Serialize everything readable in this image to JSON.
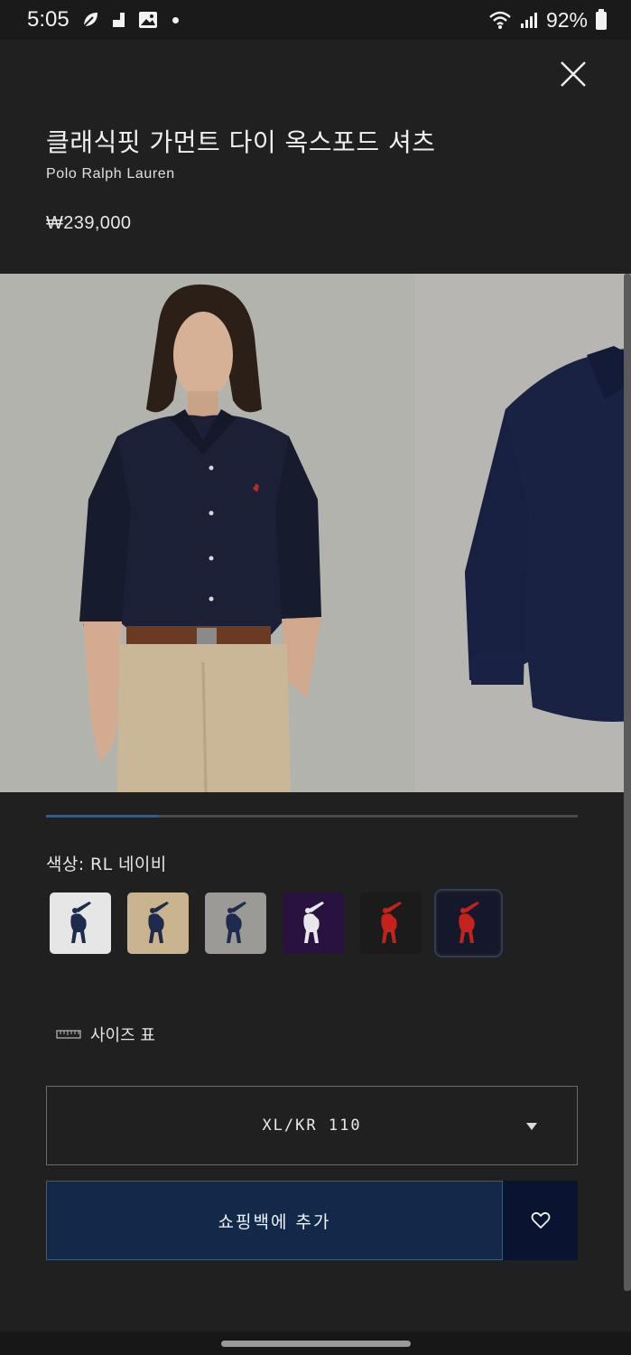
{
  "status_bar": {
    "time": "5:05",
    "battery": "92%",
    "icons": [
      "leaf-icon",
      "music-icon",
      "gallery-icon",
      "dot-icon",
      "wifi-icon",
      "signal-icon",
      "battery-icon"
    ]
  },
  "header": {
    "close_icon": "close-icon",
    "title": "클래식핏 가먼트 다이 옥스포드 셔츠",
    "brand": "Polo Ralph Lauren",
    "price": "₩239,000"
  },
  "gallery": {
    "images": [
      "model-wearing-shirt-image",
      "shirt-flat-lay-image"
    ],
    "progress": 0.21
  },
  "color": {
    "label": "색상: RL 네이비",
    "swatches": [
      {
        "name": "white",
        "bg": "#e6e6e6",
        "pony": "#1f2b4d",
        "selected": false
      },
      {
        "name": "khaki",
        "bg": "#c9b48e",
        "pony": "#1f2b4d",
        "selected": false
      },
      {
        "name": "grey",
        "bg": "#9c9a96",
        "pony": "#1f2b4d",
        "selected": false
      },
      {
        "name": "purple",
        "bg": "#2a1240",
        "pony": "#e8e8e8",
        "selected": false
      },
      {
        "name": "black",
        "bg": "#1b1b1b",
        "pony": "#c4221c",
        "selected": false
      },
      {
        "name": "navy",
        "bg": "#14182a",
        "pony": "#c4221c",
        "selected": true
      }
    ]
  },
  "size_chart": {
    "icon": "ruler-icon",
    "label": "사이즈 표"
  },
  "size_select": {
    "value": "XL/KR 110",
    "icon": "caret-down-icon"
  },
  "actions": {
    "add_to_bag": "쇼핑백에 추가",
    "wishlist_icon": "heart-icon"
  },
  "colors": {
    "background": "#202020",
    "primary_button": "#13294a",
    "wishlist_button": "#0a1430"
  }
}
